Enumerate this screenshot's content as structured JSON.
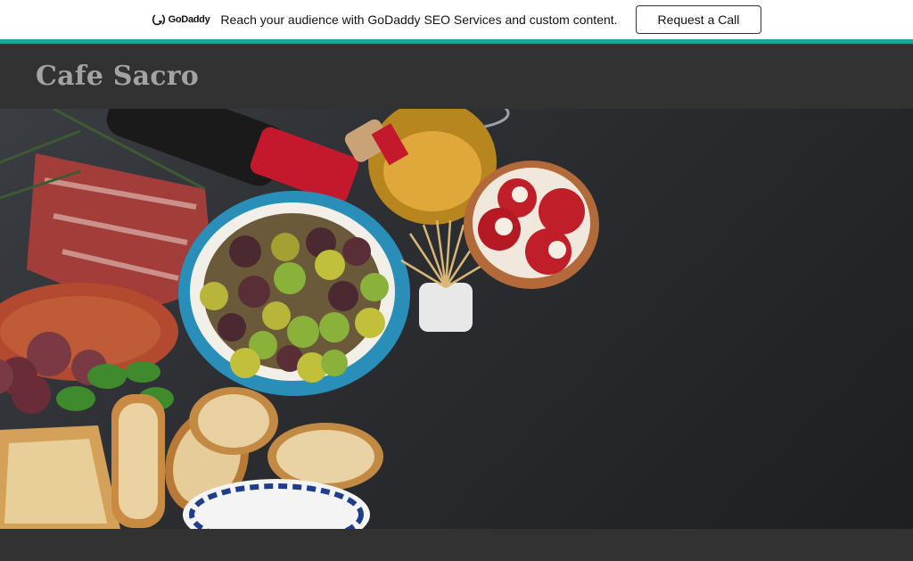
{
  "promo": {
    "brand": "GoDaddy",
    "text": "Reach your audience with GoDaddy SEO Services and custom content.",
    "button_label": "Request a Call",
    "accent_color": "#19a79a"
  },
  "header": {
    "site_title": "Cafe Sacro"
  },
  "hero": {
    "icon": "food-platter-image"
  }
}
